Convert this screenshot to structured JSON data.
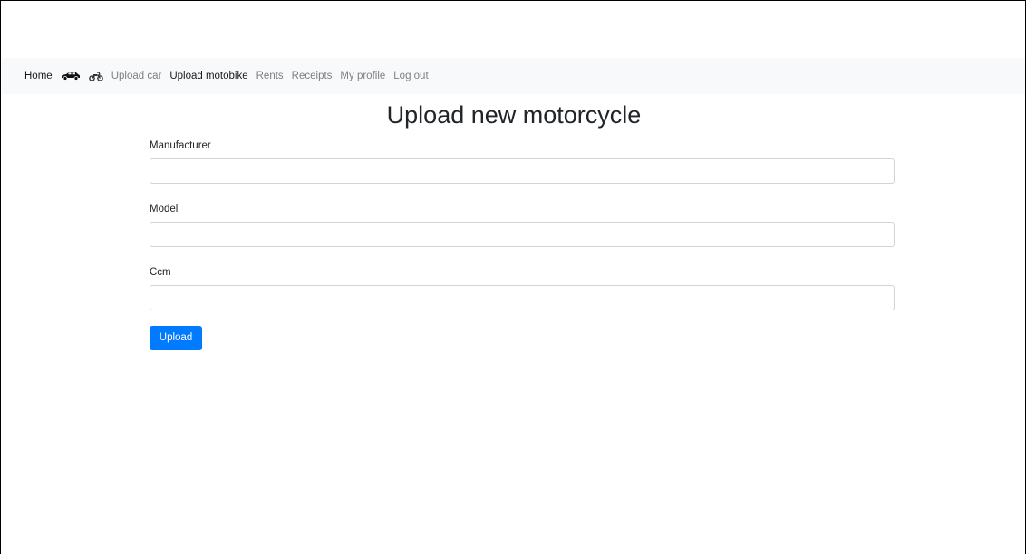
{
  "nav": {
    "home": "Home",
    "car_icon": "car-icon",
    "motorbike_icon": "motorbike-icon",
    "upload_car": "Upload car",
    "upload_motobike": "Upload motobike",
    "rents": "Rents",
    "receipts": "Receipts",
    "my_profile": "My profile",
    "log_out": "Log out"
  },
  "page": {
    "title": "Upload new motorcycle"
  },
  "form": {
    "manufacturer_label": "Manufacturer",
    "manufacturer_value": "",
    "model_label": "Model",
    "model_value": "",
    "ccm_label": "Ccm",
    "ccm_value": "",
    "submit_label": "Upload"
  },
  "colors": {
    "primary": "#007bff",
    "navbar_bg": "#f8f9fa"
  }
}
